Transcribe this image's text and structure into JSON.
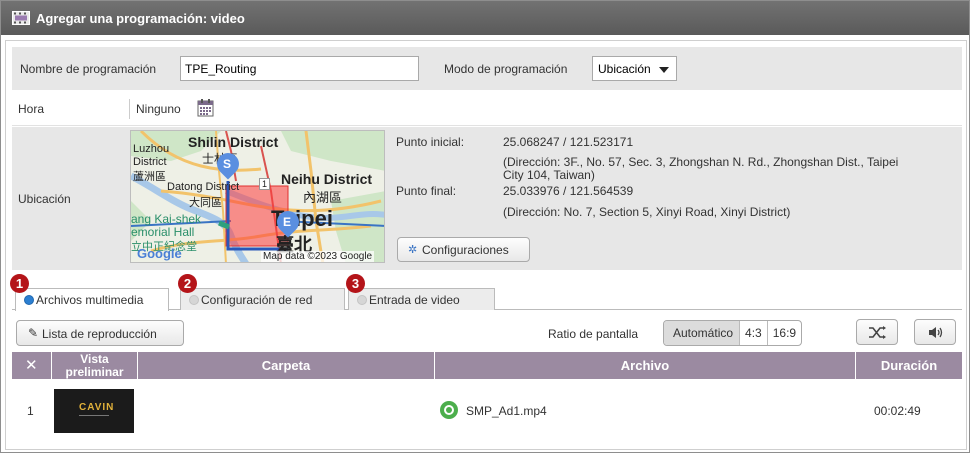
{
  "window": {
    "title": "Agregar una programación: video"
  },
  "form": {
    "schedule_name_label": "Nombre de programación",
    "schedule_name_value": "TPE_Routing",
    "mode_label": "Modo de programación",
    "mode_value": "Ubicación",
    "time_label": "Hora",
    "time_value": "Ninguno",
    "location_label": "Ubicación"
  },
  "map": {
    "labels": {
      "shilin": "Shilin District",
      "shilin_zh": "士林區",
      "luzhou": "Luzhou",
      "district": "District",
      "luzhou_zh": "蘆洲區",
      "neihu": "Neihu District",
      "neihu_zh": "內湖區",
      "datong": "Datong District",
      "datong_zh": "大同區",
      "kaishek": "ang Kai-shek",
      "memorial": "emorial Hall",
      "memorial_zh": "立中正紀念堂",
      "taipei": "Taipei",
      "taipei_zh": "臺北",
      "road_num": "1",
      "marker_start": "S",
      "marker_end": "E",
      "google": "Google",
      "attribution": "Map data ©2023 Google"
    }
  },
  "location": {
    "start_label": "Punto inicial:",
    "start_coords": "25.068247 / 121.523171",
    "start_address_line1": "(Dirección: 3F., No. 57, Sec. 3, Zhongshan N. Rd., Zhongshan Dist., Taipei",
    "start_address_line2": "City 104, Taiwan)",
    "end_label": "Punto final:",
    "end_coords": "25.033976 / 121.564539",
    "end_address": "(Dirección: No. 7, Section 5, Xinyi Road, Xinyi District)",
    "settings_button": "Configuraciones"
  },
  "tabs": [
    {
      "badge": "1",
      "label": "Archivos multimedia",
      "active": true
    },
    {
      "badge": "2",
      "label": "Configuración de red",
      "active": false
    },
    {
      "badge": "3",
      "label": "Entrada de video",
      "active": false
    }
  ],
  "toolbar": {
    "playlist_button": "Lista de reproducción",
    "ratio_label": "Ratio de pantalla",
    "ratio_options": [
      "Automático",
      "4:3",
      "16:9"
    ],
    "ratio_selected": "Automático"
  },
  "table": {
    "headers": {
      "preview_line1": "Vista",
      "preview_line2": "preliminar",
      "folder": "Carpeta",
      "file": "Archivo",
      "duration": "Duración"
    },
    "rows": [
      {
        "index": "1",
        "thumbnail_text": "CAVIN",
        "folder": "",
        "file": "SMP_Ad1.mp4",
        "duration": "00:02:49"
      }
    ]
  },
  "colors": {
    "titlebar": "#666666",
    "table_header": "#9b8aa1",
    "badge": "#b41419",
    "active_radio": "#2c7fd1",
    "status_ok": "#4cae4c"
  }
}
